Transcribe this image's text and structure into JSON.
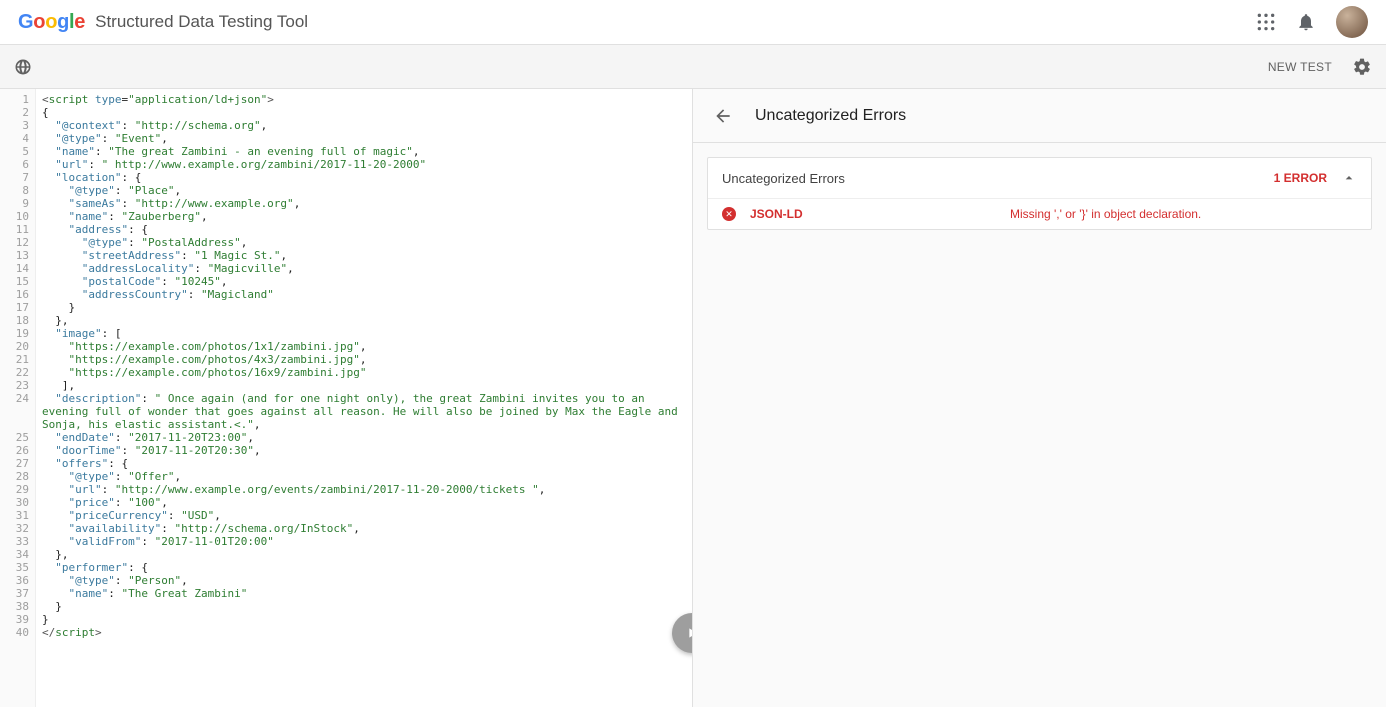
{
  "header": {
    "app_title": "Structured Data Testing Tool",
    "logo_letters": [
      "G",
      "o",
      "o",
      "g",
      "l",
      "e"
    ]
  },
  "toolbar": {
    "new_test_label": "NEW TEST"
  },
  "editor": {
    "error_line": 7,
    "lines": [
      {
        "n": 1,
        "html": "<span class='tok-pun'>&lt;</span><span class='tok-tag'>script</span> <span class='tok-attr'>type</span>=<span class='tok-str'>\"application/ld+json\"</span><span class='tok-pun'>&gt;</span>"
      },
      {
        "n": 2,
        "html": "{"
      },
      {
        "n": 3,
        "html": "  <span class='tok-key'>\"@context\"</span>: <span class='tok-str'>\"http://schema.org\"</span>,"
      },
      {
        "n": 4,
        "html": "  <span class='tok-key'>\"@type\"</span>: <span class='tok-str'>\"Event\"</span>,"
      },
      {
        "n": 5,
        "html": "  <span class='tok-key'>\"name\"</span>: <span class='tok-str'>\"The great Zambini - an evening full of magic\"</span>,"
      },
      {
        "n": 6,
        "html": "  <span class='tok-key'>\"url\"</span>: <span class='tok-str'>\" http://www.example.org/zambini/2017-11-20-2000\"</span>"
      },
      {
        "n": 7,
        "html": "  <span class='tok-key'>\"location\"</span>: {"
      },
      {
        "n": 8,
        "html": "    <span class='tok-key'>\"@type\"</span>: <span class='tok-str'>\"Place\"</span>,"
      },
      {
        "n": 9,
        "html": "    <span class='tok-key'>\"sameAs\"</span>: <span class='tok-str'>\"http://www.example.org\"</span>,"
      },
      {
        "n": 10,
        "html": "    <span class='tok-key'>\"name\"</span>: <span class='tok-str'>\"Zauberberg\"</span>,"
      },
      {
        "n": 11,
        "html": "    <span class='tok-key'>\"address\"</span>: {"
      },
      {
        "n": 12,
        "html": "      <span class='tok-key'>\"@type\"</span>: <span class='tok-str'>\"PostalAddress\"</span>,"
      },
      {
        "n": 13,
        "html": "      <span class='tok-key'>\"streetAddress\"</span>: <span class='tok-str'>\"1 Magic St.\"</span>,"
      },
      {
        "n": 14,
        "html": "      <span class='tok-key'>\"addressLocality\"</span>: <span class='tok-str'>\"Magicville\"</span>,"
      },
      {
        "n": 15,
        "html": "      <span class='tok-key'>\"postalCode\"</span>: <span class='tok-str'>\"10245\"</span>,"
      },
      {
        "n": 16,
        "html": "      <span class='tok-key'>\"addressCountry\"</span>: <span class='tok-str'>\"Magicland\"</span>"
      },
      {
        "n": 17,
        "html": "    }"
      },
      {
        "n": 18,
        "html": "  },"
      },
      {
        "n": 19,
        "html": "  <span class='tok-key'>\"image\"</span>: ["
      },
      {
        "n": 20,
        "html": "    <span class='tok-str'>\"https://example.com/photos/1x1/zambini.jpg\"</span>,"
      },
      {
        "n": 21,
        "html": "    <span class='tok-str'>\"https://example.com/photos/4x3/zambini.jpg\"</span>,"
      },
      {
        "n": 22,
        "html": "    <span class='tok-str'>\"https://example.com/photos/16x9/zambini.jpg\"</span>"
      },
      {
        "n": 23,
        "html": "   ],"
      },
      {
        "n": 24,
        "wrap": true,
        "html": "  <span class='tok-key'>\"description\"</span>: <span class='tok-str'>\" Once again (and for one night only), the great Zambini invites you to an evening full of wonder that goes against all reason. He will also be joined by Max the Eagle and Sonja, his elastic assistant.&lt;.\"</span>,"
      },
      {
        "n": 25,
        "html": "  <span class='tok-key'>\"endDate\"</span>: <span class='tok-str'>\"2017-11-20T23:00\"</span>,"
      },
      {
        "n": 26,
        "html": "  <span class='tok-key'>\"doorTime\"</span>: <span class='tok-str'>\"2017-11-20T20:30\"</span>,"
      },
      {
        "n": 27,
        "html": "  <span class='tok-key'>\"offers\"</span>: {"
      },
      {
        "n": 28,
        "html": "    <span class='tok-key'>\"@type\"</span>: <span class='tok-str'>\"Offer\"</span>,"
      },
      {
        "n": 29,
        "html": "    <span class='tok-key'>\"url\"</span>: <span class='tok-str'>\"http://www.example.org/events/zambini/2017-11-20-2000/tickets \"</span>,"
      },
      {
        "n": 30,
        "html": "    <span class='tok-key'>\"price\"</span>: <span class='tok-str'>\"100\"</span>,"
      },
      {
        "n": 31,
        "html": "    <span class='tok-key'>\"priceCurrency\"</span>: <span class='tok-str'>\"USD\"</span>,"
      },
      {
        "n": 32,
        "html": "    <span class='tok-key'>\"availability\"</span>: <span class='tok-str'>\"http://schema.org/InStock\"</span>,"
      },
      {
        "n": 33,
        "html": "    <span class='tok-key'>\"validFrom\"</span>: <span class='tok-str'>\"2017-11-01T20:00\"</span>"
      },
      {
        "n": 34,
        "html": "  },"
      },
      {
        "n": 35,
        "html": "  <span class='tok-key'>\"performer\"</span>: {"
      },
      {
        "n": 36,
        "html": "    <span class='tok-key'>\"@type\"</span>: <span class='tok-str'>\"Person\"</span>,"
      },
      {
        "n": 37,
        "html": "    <span class='tok-key'>\"name\"</span>: <span class='tok-str'>\"The Great Zambini\"</span>"
      },
      {
        "n": 38,
        "html": "  }"
      },
      {
        "n": 39,
        "html": "}"
      },
      {
        "n": 40,
        "html": "<span class='tok-pun'>&lt;/</span><span class='tok-tag'>script</span><span class='tok-pun'>&gt;</span>"
      }
    ]
  },
  "results": {
    "title": "Uncategorized Errors",
    "card": {
      "title": "Uncategorized Errors",
      "error_count_label": "1 ERROR",
      "rows": [
        {
          "type": "JSON-LD",
          "message": "Missing ',' or '}' in object declaration."
        }
      ]
    }
  }
}
